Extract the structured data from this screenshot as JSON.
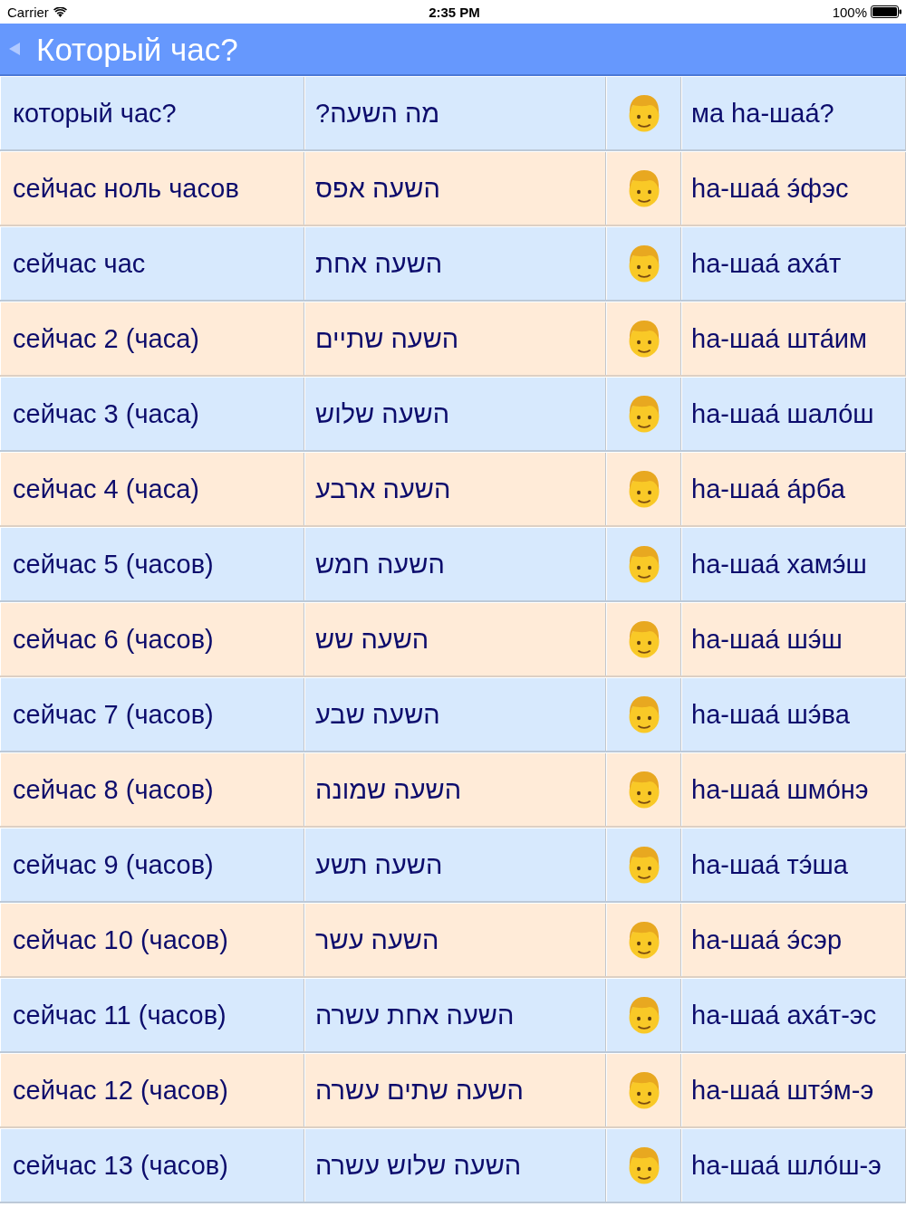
{
  "status_bar": {
    "carrier": "Carrier",
    "time": "2:35 PM",
    "battery": "100%"
  },
  "nav_bar": {
    "title": "Который час?"
  },
  "rows": [
    {
      "russian": "который час?",
      "hebrew": "מה השעה?",
      "transliteration": "ма hа-шаа́?"
    },
    {
      "russian": "сейчас ноль часов",
      "hebrew": "השעה אפס",
      "transliteration": "hа-шаа́ э́фэс"
    },
    {
      "russian": "сейчас час",
      "hebrew": "השעה אחת",
      "transliteration": "hа-шаа́ аха́т"
    },
    {
      "russian": "сейчас 2 (часа)",
      "hebrew": "השעה שתיים",
      "transliteration": "hа-шаа́ шта́им"
    },
    {
      "russian": "сейчас 3 (часа)",
      "hebrew": "השעה שלוש",
      "transliteration": "hа-шаа́ шало́ш"
    },
    {
      "russian": "сейчас 4 (часа)",
      "hebrew": "השעה ארבע",
      "transliteration": "hа-шаа́ а́рба"
    },
    {
      "russian": "сейчас 5 (часов)",
      "hebrew": "השעה חמש",
      "transliteration": "hа-шаа́ хамэ́ш"
    },
    {
      "russian": "сейчас 6 (часов)",
      "hebrew": "השעה שש",
      "transliteration": "hа-шаа́ шэ́ш"
    },
    {
      "russian": "сейчас 7 (часов)",
      "hebrew": "השעה שבע",
      "transliteration": "hа-шаа́ шэ́ва"
    },
    {
      "russian": "сейчас 8 (часов)",
      "hebrew": "השעה שמונה",
      "transliteration": "hа-шаа́ шмо́нэ"
    },
    {
      "russian": "сейчас 9 (часов)",
      "hebrew": "השעה תשע",
      "transliteration": "hа-шаа́ тэ́ша"
    },
    {
      "russian": "сейчас 10 (часов)",
      "hebrew": "השעה עשר",
      "transliteration": "hа-шаа́ э́сэр"
    },
    {
      "russian": "сейчас 11 (часов)",
      "hebrew": "השעה אחת עשרה",
      "transliteration": "hа-шаа́ аха́т-эс"
    },
    {
      "russian": "сейчас 12 (часов)",
      "hebrew": "השעה שתים עשרה",
      "transliteration": "hа-шаа́ штэ́м-э"
    },
    {
      "russian": "сейчас 13 (часов)",
      "hebrew": "השעה שלוש עשרה",
      "transliteration": "hа-шаа́ шло́ш-э"
    }
  ]
}
